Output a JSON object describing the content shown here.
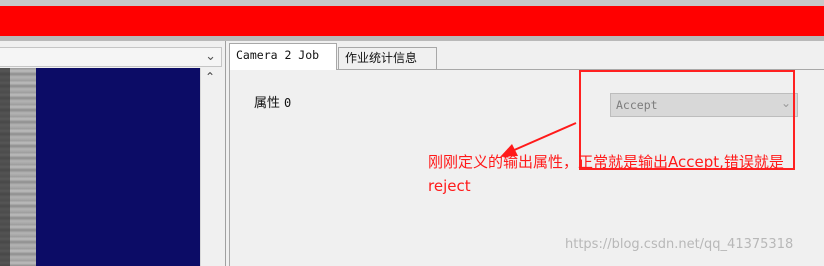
{
  "left_panel": {
    "header_dropdown_icon": "chevron-down-icon",
    "scroll_up_icon": "scroll-up-arrow-icon"
  },
  "tabs": [
    {
      "label": "Camera 2 Job",
      "active": true
    },
    {
      "label": "作业统计信息",
      "active": false
    }
  ],
  "property": {
    "label": "属性",
    "index": "0",
    "selected_value": "Accept",
    "dropdown_icon": "chevron-down-icon"
  },
  "annotation": {
    "text": "刚刚定义的输出属性，正常就是输出Accept,错误就是reject",
    "color": "#ff1a1a"
  },
  "watermark": "https://blog.csdn.net/qq_41375318",
  "colors": {
    "title_bar": "#ff0000",
    "camera_view": "#0c0c66"
  }
}
